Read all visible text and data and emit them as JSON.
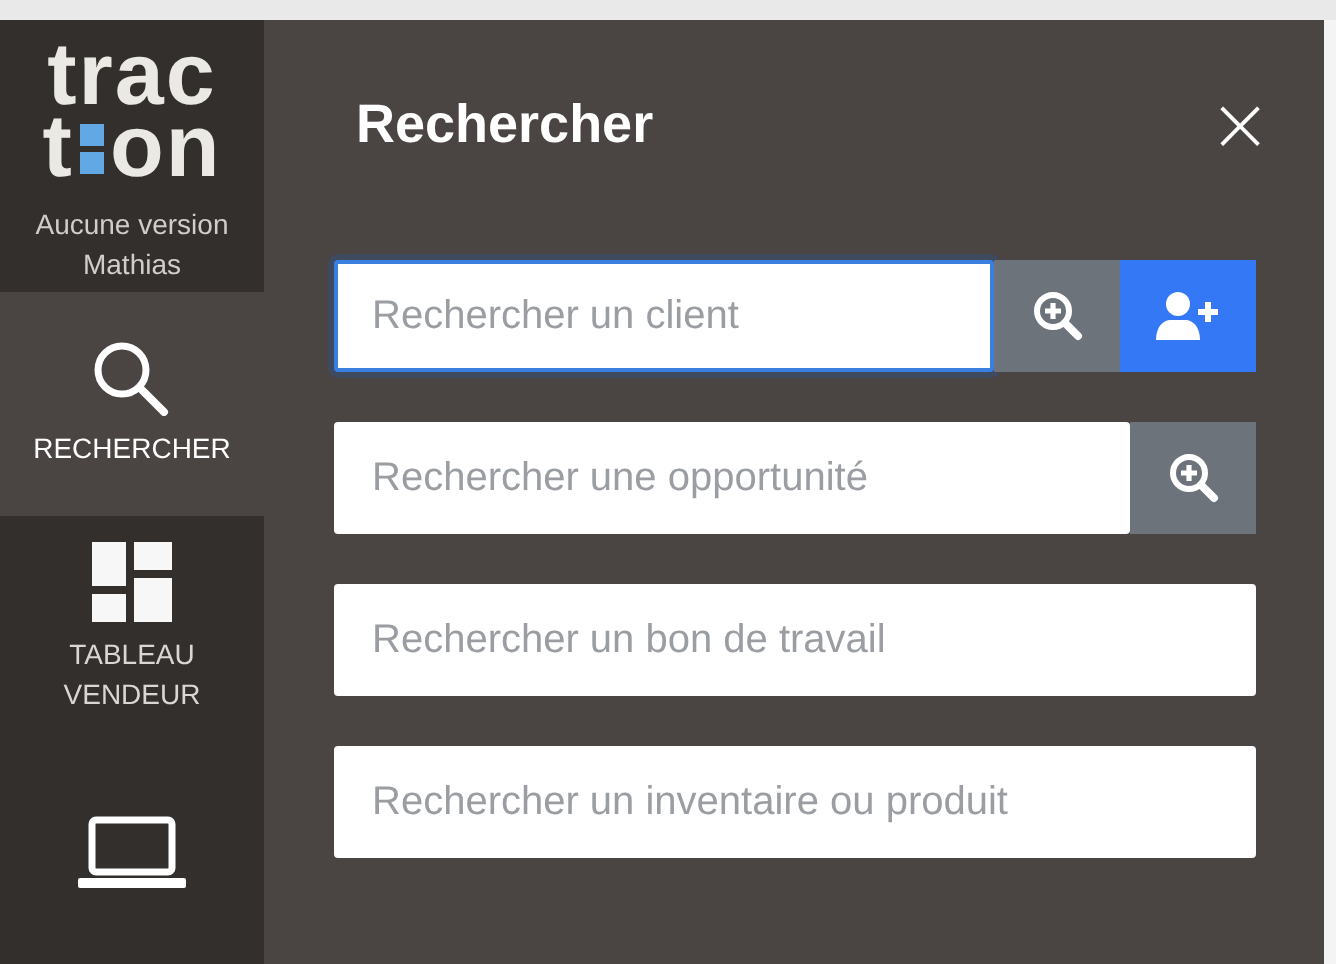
{
  "logo": {
    "first": "trac",
    "second_start": "t",
    "second_end": "on"
  },
  "version": {
    "name": "Aucune version",
    "user": "Mathias"
  },
  "nav": [
    {
      "kind": "search",
      "label": "RECHERCHER",
      "selected": true
    },
    {
      "kind": "dashboard",
      "label": "TABLEAU VENDEUR",
      "selected": false
    },
    {
      "kind": "laptop",
      "selected": false
    }
  ],
  "panel": {
    "title": "Rechercher",
    "close": "×"
  },
  "fields": [
    {
      "placeholder": "Rechercher un client",
      "focused": true,
      "buttons": [
        {
          "kind": "search"
        },
        {
          "kind": "add-client"
        }
      ]
    },
    {
      "placeholder": "Rechercher une opportunité",
      "focused": false,
      "buttons": [
        {
          "kind": "search"
        }
      ]
    },
    {
      "placeholder": "Rechercher un bon de travail",
      "focused": false
    },
    {
      "placeholder": "Rechercher un inventaire ou produit",
      "focused": false
    }
  ]
}
